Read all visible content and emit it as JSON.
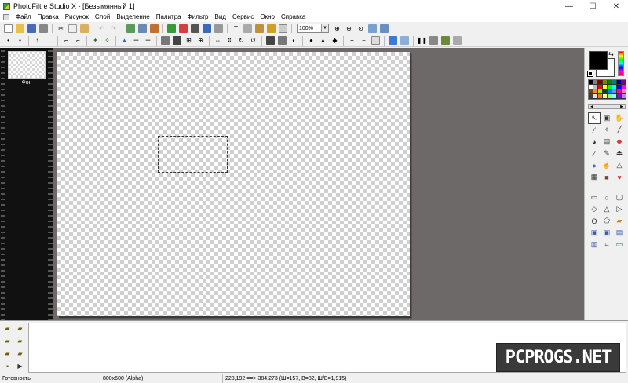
{
  "window": {
    "title": "PhotoFiltre Studio X - [Безымянный 1]",
    "minimize": "—",
    "maximize": "☐",
    "close": "✕"
  },
  "menu": [
    "Файл",
    "Правка",
    "Рисунок",
    "Слой",
    "Выделение",
    "Палитра",
    "Фильтр",
    "Вид",
    "Сервис",
    "Окно",
    "Справка"
  ],
  "toolbar": {
    "zoom_value": "100%"
  },
  "layers": [
    {
      "name": "Фон"
    }
  ],
  "colors": {
    "foreground": "#000000",
    "background": "#ffffff",
    "workspace": "#6d6968"
  },
  "palette": [
    "#000000",
    "#808080",
    "#800000",
    "#808000",
    "#008000",
    "#008080",
    "#000080",
    "#800080",
    "#ffffff",
    "#c0c0c0",
    "#ff0000",
    "#ffff00",
    "#00ff00",
    "#00ffff",
    "#0000ff",
    "#ff00ff",
    "#804000",
    "#ff8040",
    "#80ff00",
    "#004040",
    "#0080ff",
    "#8080ff",
    "#ff0080",
    "#ff80c0",
    "#404040",
    "#e0e0e0",
    "#ff8000",
    "#ffff80",
    "#80ff80",
    "#80ffff",
    "#8000ff",
    "#c080ff"
  ],
  "tools": {
    "group1": [
      "arrow-icon",
      "magic-select-icon",
      "hand-icon",
      "eyedropper-icon",
      "magic-wand-icon",
      "line-icon",
      "bucket-icon",
      "spray-icon",
      "eraser-icon",
      "brush-icon",
      "pen-icon",
      "stamp-icon",
      "blur-drop-icon",
      "finger-icon",
      "sharpen-icon",
      "pattern-icon",
      "clone-icon",
      "strawberry-icon"
    ],
    "group2": [
      "rectangle-icon",
      "ellipse-icon",
      "rounded-rect-icon",
      "diamond-icon",
      "triangle-icon",
      "right-triangle-icon",
      "lasso-icon",
      "polygon-lasso-icon",
      "folder-icon",
      "select-all-icon",
      "invert-select-icon",
      "hide-select-icon",
      "layer-select-icon",
      "crop-icon",
      "frame-icon"
    ]
  },
  "statusbar": {
    "state": "Готовность",
    "image_info": "800x600 (Alpha)",
    "coords": "228,192 ==> 384,273 (Ш=157, В=82, Ш/В=1,915)"
  },
  "watermark": "PCPROGS.NET"
}
